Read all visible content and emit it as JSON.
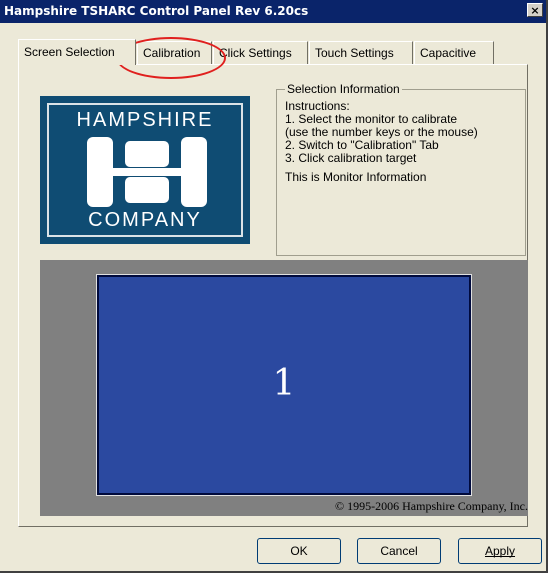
{
  "window": {
    "title": "Hampshire TSHARC Control Panel Rev 6.20cs",
    "close_symbol": "×"
  },
  "tabs": [
    {
      "label": "Screen Selection",
      "active": true
    },
    {
      "label": "Calibration",
      "active": false
    },
    {
      "label": "Click Settings",
      "active": false
    },
    {
      "label": "Touch Settings",
      "active": false
    },
    {
      "label": "Capacitive",
      "active": false
    }
  ],
  "logo": {
    "top_text": "HAMPSHIRE",
    "bottom_text": "COMPANY",
    "brand_color": "#0f4c73"
  },
  "selection_info": {
    "legend": "Selection Information",
    "lines": [
      "Instructions:",
      "1. Select the monitor to calibrate",
      "(use the number keys or the mouse)",
      "2. Switch to \"Calibration\" Tab",
      "3. Click calibration target",
      "This is Monitor Information"
    ]
  },
  "monitor": {
    "number": "1",
    "color": "#2b49a0"
  },
  "copyright": "© 1995-2006 Hampshire Company, Inc.",
  "buttons": {
    "ok": "OK",
    "cancel": "Cancel",
    "apply": "Apply"
  },
  "annotation": {
    "color": "#e0201e",
    "target": "Calibration tab"
  }
}
